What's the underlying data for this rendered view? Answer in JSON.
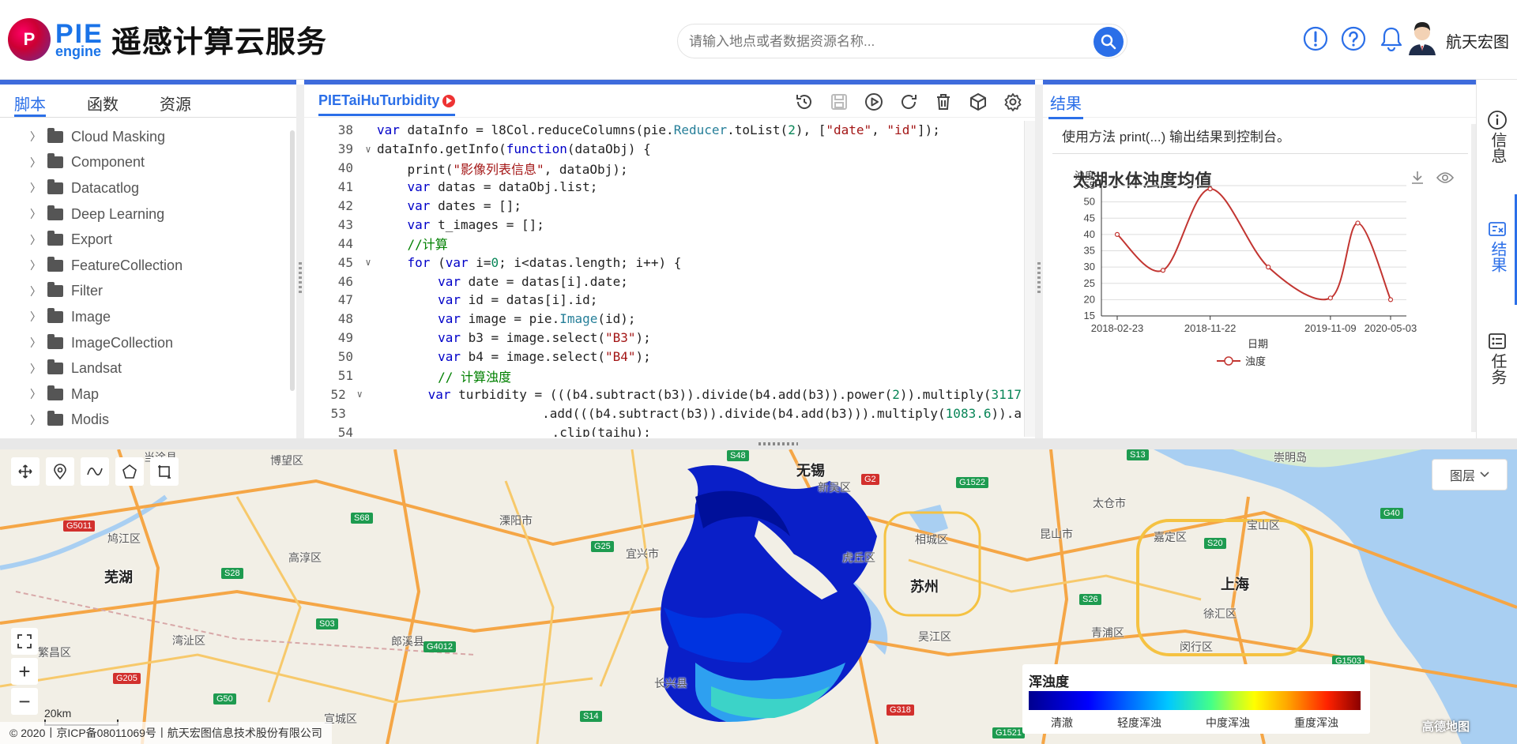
{
  "header": {
    "logo_badge": "P",
    "logo_pie": "PIE",
    "logo_engine": "engine",
    "title": "遥感计算云服务",
    "search_placeholder": "请输入地点或者数据资源名称...",
    "user_name": "航天宏图"
  },
  "left_panel": {
    "tabs": [
      {
        "label": "脚本",
        "active": true
      },
      {
        "label": "函数",
        "active": false
      },
      {
        "label": "资源",
        "active": false
      }
    ],
    "tree": [
      "Cloud Masking",
      "Component",
      "Datacatlog",
      "Deep Learning",
      "Export",
      "FeatureCollection",
      "Filter",
      "Image",
      "ImageCollection",
      "Landsat",
      "Map",
      "Modis"
    ]
  },
  "editor": {
    "file_name": "PIETaiHuTurbidity",
    "lines": [
      {
        "n": "38",
        "fold": "",
        "html": "<span class=\"kw\">var</span> dataInfo = l8Col.reduceColumns(pie.<span class=\"fn\">Reducer</span>.toList(<span class=\"num\">2</span>), [<span class=\"str\">\"date\"</span>, <span class=\"str\">\"id\"</span>]);"
      },
      {
        "n": "39",
        "fold": "v",
        "html": "dataInfo.getInfo(<span class=\"kw\">function</span>(dataObj) {"
      },
      {
        "n": "40",
        "fold": "",
        "html": "    print(<span class=\"str\">\"影像列表信息\"</span>, dataObj);"
      },
      {
        "n": "41",
        "fold": "",
        "html": "    <span class=\"kw\">var</span> datas = dataObj.list;"
      },
      {
        "n": "42",
        "fold": "",
        "html": "    <span class=\"kw\">var</span> dates = [];"
      },
      {
        "n": "43",
        "fold": "",
        "html": "    <span class=\"kw\">var</span> t_images = [];"
      },
      {
        "n": "44",
        "fold": "",
        "html": "    <span class=\"cm\">//计算</span>"
      },
      {
        "n": "45",
        "fold": "v",
        "html": "    <span class=\"kw\">for</span> (<span class=\"kw\">var</span> i=<span class=\"num\">0</span>; i&lt;datas.length; i++) {"
      },
      {
        "n": "46",
        "fold": "",
        "html": "        <span class=\"kw\">var</span> date = datas[i].date;"
      },
      {
        "n": "47",
        "fold": "",
        "html": "        <span class=\"kw\">var</span> id = datas[i].id;"
      },
      {
        "n": "48",
        "fold": "",
        "html": "        <span class=\"kw\">var</span> image = pie.<span class=\"fn\">Image</span>(id);"
      },
      {
        "n": "49",
        "fold": "",
        "html": "        <span class=\"kw\">var</span> b3 = image.select(<span class=\"str\">\"B3\"</span>);"
      },
      {
        "n": "50",
        "fold": "",
        "html": "        <span class=\"kw\">var</span> b4 = image.select(<span class=\"str\">\"B4\"</span>);"
      },
      {
        "n": "51",
        "fold": "",
        "html": "        <span class=\"cm\">// 计算浊度</span>"
      },
      {
        "n": "52",
        "fold": "v",
        "html": "        <span class=\"kw\">var</span> turbidity = (((b4.subtract(b3)).divide(b4.add(b3)).power(<span class=\"num\">2</span>)).multiply(<span class=\"num\">3117</span>"
      },
      {
        "n": "53",
        "fold": "",
        "html": "                       .add(((b4.subtract(b3)).divide(b4.add(b3))).multiply(<span class=\"num\">1083.6</span>)).a"
      },
      {
        "n": "54",
        "fold": "",
        "html": "                       .clip(taihu);"
      }
    ]
  },
  "result": {
    "tab": "结果",
    "hint": "使用方法 print(...) 输出结果到控制台。"
  },
  "chart_data": {
    "type": "line",
    "title": "太湖水体浊度均值",
    "ylabel": "浊度",
    "xlabel": "日期",
    "ylim": [
      15,
      55
    ],
    "yticks": [
      15,
      20,
      25,
      30,
      35,
      40,
      45,
      50,
      55
    ],
    "xtick_labels": [
      "2018-02-23",
      "2018-11-22",
      "2019-11-09",
      "2020-05-03"
    ],
    "x": [
      "2018-02-23",
      "2018-07-07",
      "2018-11-22",
      "2019-05-11",
      "2019-11-09",
      "2020-01-28",
      "2020-05-03"
    ],
    "series": [
      {
        "name": "浊度",
        "values": [
          40,
          29,
          54,
          30,
          20.5,
          43.5,
          20
        ]
      }
    ],
    "smooth": true,
    "color": "#c23531",
    "grid": true,
    "legend": "bottom-center"
  },
  "right_sidebar": [
    {
      "label": "信息",
      "active": false
    },
    {
      "label": "结果",
      "active": true
    },
    {
      "label": "任务",
      "active": false
    }
  ],
  "map": {
    "layers_label": "图层",
    "legend_title": "浑浊度",
    "legend_labels": [
      "清澈",
      "轻度浑浊",
      "中度浑浊",
      "重度浑浊"
    ],
    "scale_label": "20km",
    "copyright": "© 2020丨京ICP备08011069号丨航天宏图信息技术股份有限公司",
    "provider": "高德地图",
    "cities": [
      "无锡",
      "苏州",
      "上海",
      "芜湖"
    ],
    "towns": [
      "当涂县",
      "博望区",
      "鸠江区",
      "高淳区",
      "溧阳市",
      "宜兴市",
      "虎丘区",
      "相城区",
      "太仓市",
      "昆山市",
      "嘉定区",
      "宝山区",
      "吴江区",
      "青浦区",
      "徐汇区",
      "闵行区",
      "长兴县",
      "郎溪县",
      "湾沚区",
      "繁昌区",
      "新吴区",
      "崇明岛",
      "宣城区"
    ],
    "road_shields": [
      "G5011",
      "S68",
      "S48",
      "G2",
      "G1522",
      "S20",
      "G40",
      "S28",
      "S03",
      "G4012",
      "G205",
      "G50",
      "S14",
      "S26",
      "G318",
      "G1503",
      "G1521",
      "S13",
      "G25"
    ]
  }
}
